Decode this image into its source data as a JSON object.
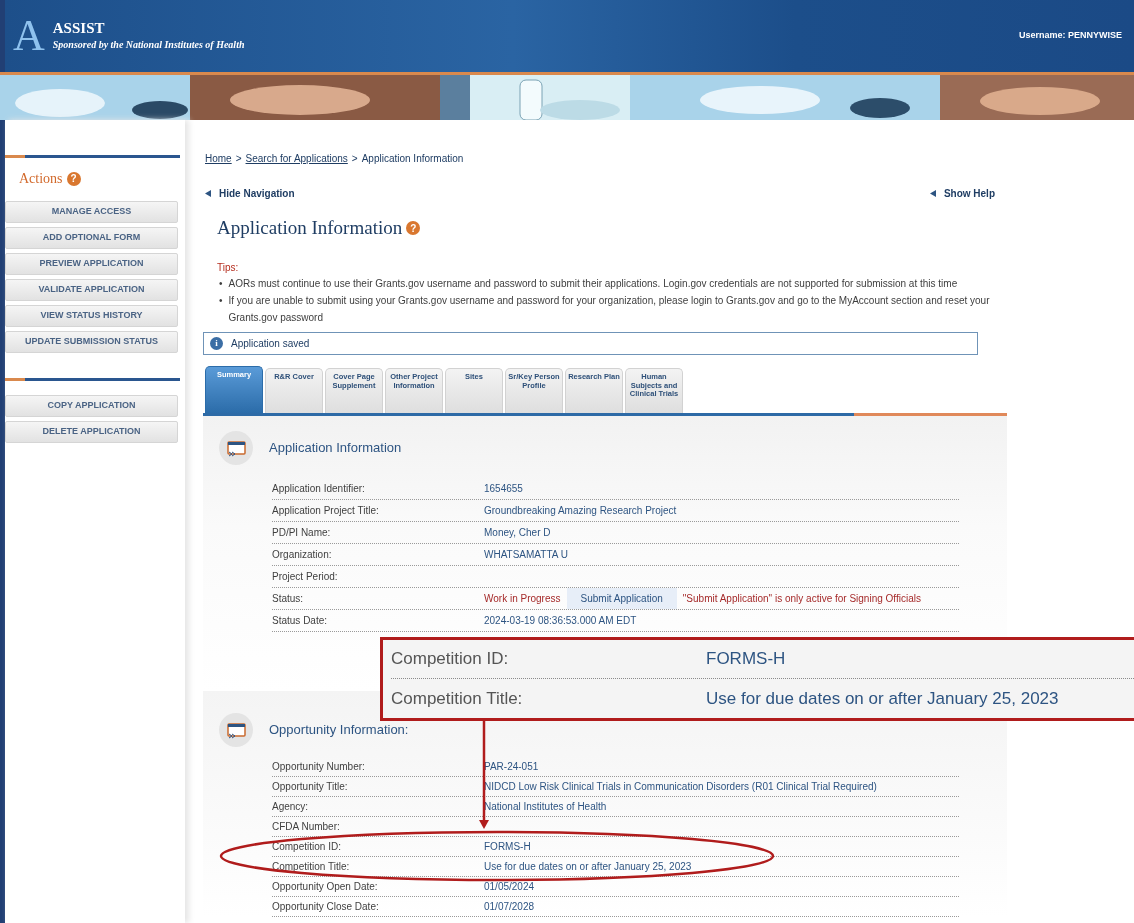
{
  "header": {
    "logo_letter": "A",
    "title": "ASSIST",
    "subtitle": "Sponsored by the National Institutes of Health",
    "username": "Username: PENNYWISE"
  },
  "sidebar": {
    "heading": "Actions",
    "help": "?",
    "groups": [
      [
        "MANAGE ACCESS",
        "ADD OPTIONAL FORM",
        "PREVIEW APPLICATION",
        "VALIDATE APPLICATION",
        "VIEW STATUS HISTORY",
        "UPDATE SUBMISSION STATUS"
      ],
      [
        "COPY APPLICATION",
        "DELETE APPLICATION"
      ]
    ]
  },
  "breadcrumb": {
    "separator": ">",
    "items": [
      {
        "label": "Home",
        "link": true
      },
      {
        "label": "Search for Applications",
        "link": true
      },
      {
        "label": "Application Information",
        "link": false
      }
    ]
  },
  "hide_navigation": "Hide Navigation",
  "show_help": "Show Help",
  "page_title": {
    "text": "Application Information",
    "help": "?"
  },
  "tips": {
    "label": "Tips:",
    "bullet": "•",
    "items": [
      "AORs must continue to use their Grants.gov username and password to submit their applications. Login.gov credentials are not supported for submission at this time",
      "If you are unable to submit using your Grants.gov username and password for your organization, please login to Grants.gov and go to the MyAccount section and reset your Grants.gov password"
    ]
  },
  "alert": {
    "icon": "i",
    "text": "Application saved"
  },
  "tabs": [
    {
      "label": "Summary",
      "selected": true
    },
    {
      "label": "R&R Cover",
      "selected": false
    },
    {
      "label": "Cover Page Supplement",
      "selected": false
    },
    {
      "label": "Other Project Information",
      "selected": false
    },
    {
      "label": "Sites",
      "selected": false
    },
    {
      "label": "Sr/Key Person Profile",
      "selected": false
    },
    {
      "label": "Research Plan",
      "selected": false
    },
    {
      "label": "Human Subjects and Clinical Trials",
      "selected": false
    }
  ],
  "sections": [
    {
      "title": "Application Information",
      "rows": [
        {
          "kind": "text",
          "label": "Application Identifier:",
          "value": "1654655"
        },
        {
          "kind": "text",
          "label": "Application Project Title:",
          "value": "Groundbreaking Amazing Research Project"
        },
        {
          "kind": "text",
          "label": "PD/PI Name:",
          "value": "Money, Cher D"
        },
        {
          "kind": "text",
          "label": "Organization:",
          "value": "WHATSAMATTA U"
        },
        {
          "kind": "text",
          "label": "Project Period:"
        },
        {
          "kind": "status",
          "label": "Status:",
          "value": "Work in Progress",
          "button": "Submit Application",
          "note": "\"Submit Application\" is only active for Signing Officials"
        },
        {
          "kind": "text",
          "label": "Status Date:",
          "value": "2024-03-19 08:36:53.000 AM EDT"
        }
      ]
    },
    {
      "title": "Opportunity Information:",
      "rows": [
        {
          "kind": "text",
          "label": "Opportunity Number:",
          "value": "PAR-24-051"
        },
        {
          "kind": "text",
          "label": "Opportunity Title:",
          "value": "NIDCD Low Risk Clinical Trials in Communication Disorders (R01 Clinical Trial Required)"
        },
        {
          "kind": "text",
          "label": "Agency:",
          "value": "National Institutes of Health"
        },
        {
          "kind": "text",
          "label": "CFDA Number:"
        },
        {
          "kind": "text",
          "label": "Competition ID:",
          "value": "FORMS-H"
        },
        {
          "kind": "text",
          "label": "Competition Title:",
          "value": "Use for due dates on or after January 25, 2023"
        },
        {
          "kind": "text",
          "label": "Opportunity Open Date:",
          "value": "01/05/2024"
        },
        {
          "kind": "text",
          "label": "Opportunity Close Date:",
          "value": "01/07/2028"
        }
      ]
    }
  ],
  "callout": {
    "rows": [
      {
        "label": "Competition ID:",
        "value": "FORMS-H"
      },
      {
        "label": "Competition Title:",
        "value": "Use for due dates on or after January 25, 2023"
      }
    ]
  }
}
